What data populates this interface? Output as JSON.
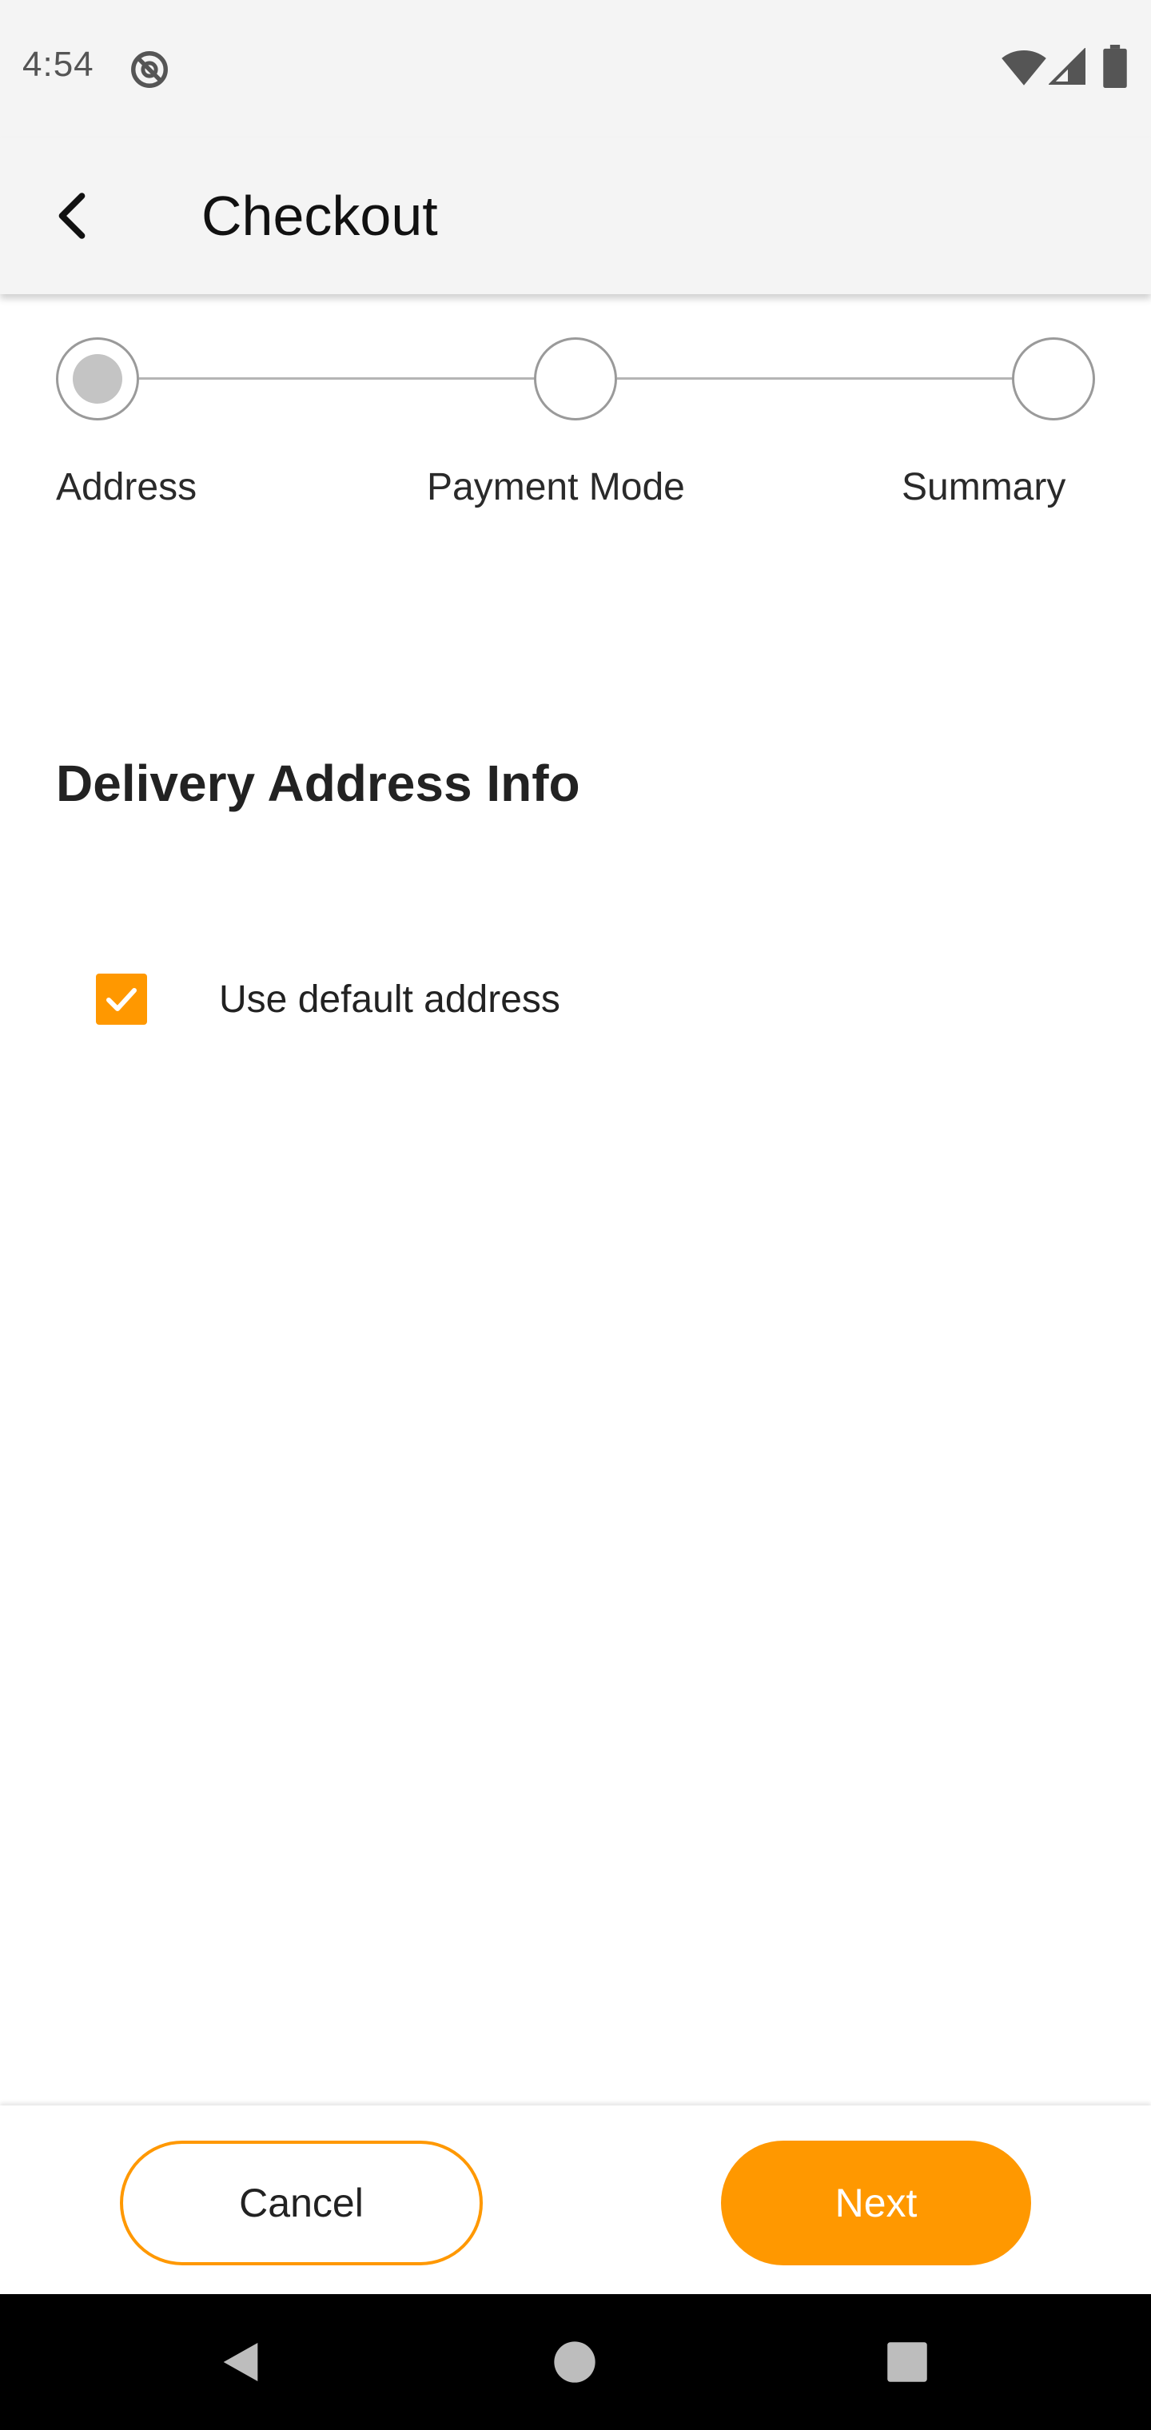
{
  "status_bar": {
    "time": "4:54",
    "icons": [
      "do-not-disturb-icon",
      "wifi-icon",
      "signal-icon",
      "battery-icon"
    ]
  },
  "app_bar": {
    "back_icon": "chevron-left-icon",
    "title": "Checkout"
  },
  "stepper": {
    "steps": [
      {
        "label": "Address",
        "state": "current"
      },
      {
        "label": "Payment Mode",
        "state": "pending"
      },
      {
        "label": "Summary",
        "state": "pending"
      }
    ]
  },
  "delivery": {
    "section_title": "Delivery Address Info",
    "use_default": {
      "label": "Use default address",
      "checked": true
    }
  },
  "actions": {
    "cancel_label": "Cancel",
    "next_label": "Next"
  },
  "nav_bar": {
    "icons": [
      "back-triangle-icon",
      "home-circle-icon",
      "recents-square-icon"
    ]
  },
  "colors": {
    "accent": "#ff9800",
    "app_bar_bg": "#f4f4f4",
    "text": "#222222",
    "step_dot": "#c4c4c4",
    "nav_bar_bg": "#000000"
  }
}
